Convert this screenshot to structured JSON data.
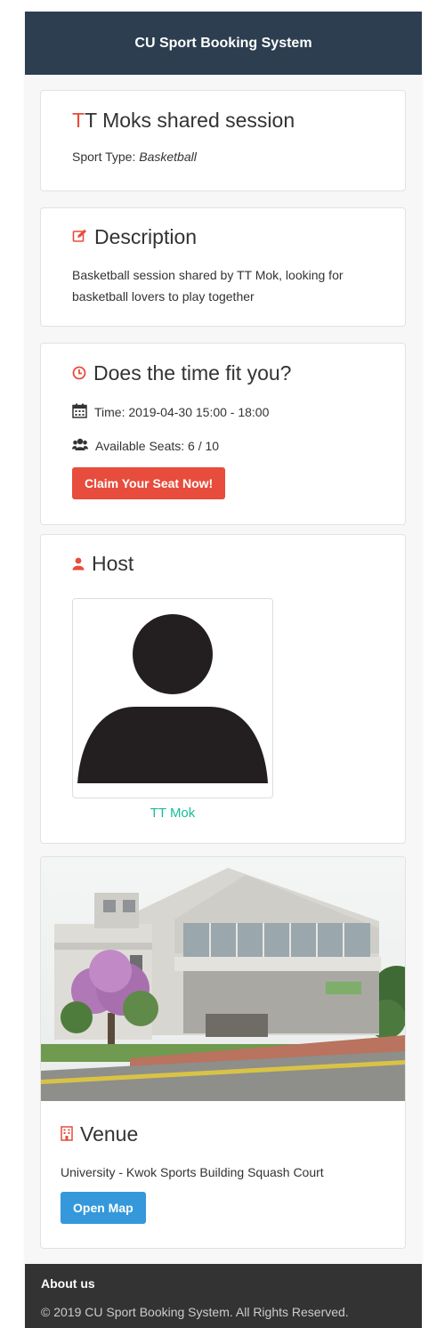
{
  "header": {
    "title": "CU Sport Booking System"
  },
  "session": {
    "title_initial": "T",
    "title_rest": "T Moks shared session",
    "sport_type_label": "Sport Type: ",
    "sport_type_value": "Basketball"
  },
  "description": {
    "heading": "Description",
    "text": "Basketball session shared by TT Mok, looking for basketball lovers to play together"
  },
  "time_section": {
    "heading": "Does the time fit you?",
    "time_text": "Time: 2019-04-30 15:00 - 18:00",
    "seats_text": "Available Seats: 6 / 10",
    "claim_button": "Claim Your Seat Now!"
  },
  "host": {
    "heading": "Host",
    "name": "TT Mok"
  },
  "venue": {
    "heading": "Venue",
    "name": "University - Kwok Sports Building Squash Court",
    "open_map_button": "Open Map"
  },
  "footer": {
    "about": "About us",
    "copyright": "© 2019 CU Sport Booking System. All Rights Reserved."
  },
  "colors": {
    "navbar": "#2c3e50",
    "accent_red": "#e74c3c",
    "accent_blue": "#3498db",
    "host_link": "#18bc9c",
    "footer": "#333333"
  }
}
